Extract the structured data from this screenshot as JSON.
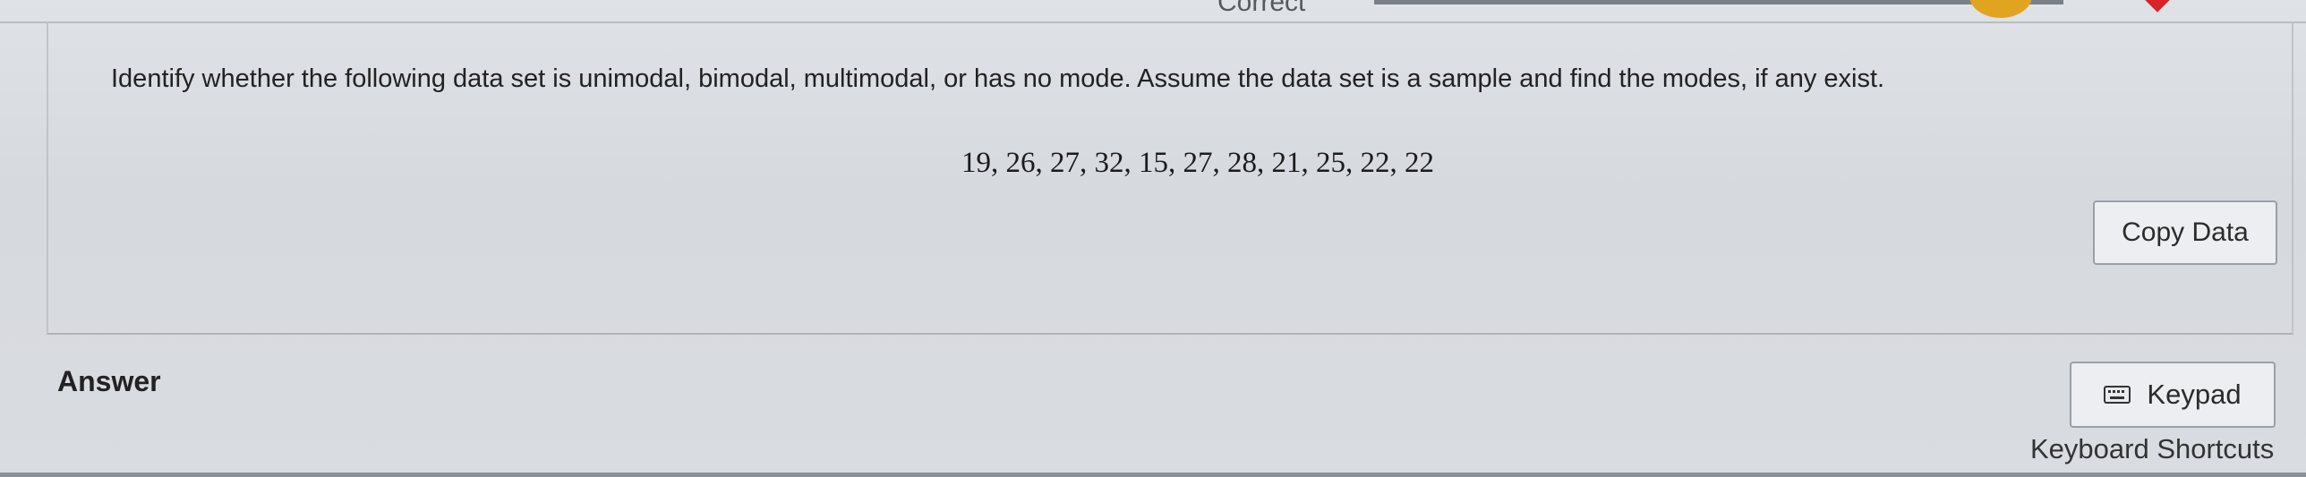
{
  "header": {
    "status_text": "Correct"
  },
  "question": {
    "prompt": "Identify whether the following data set is unimodal, bimodal, multimodal, or has no mode. Assume the data set is a sample and find the modes, if any exist.",
    "data_set": "19, 26, 27, 32, 15, 27, 28, 21, 25, 22, 22",
    "copy_data_label": "Copy Data"
  },
  "answer": {
    "label": "Answer",
    "keypad_label": "Keypad",
    "keypad_icon": "keyboard-icon",
    "keyboard_shortcuts_label": "Keyboard Shortcuts"
  },
  "colors": {
    "background": "#d8dbe0",
    "accent_gold": "#e0a420",
    "accent_red": "#d8232a"
  }
}
